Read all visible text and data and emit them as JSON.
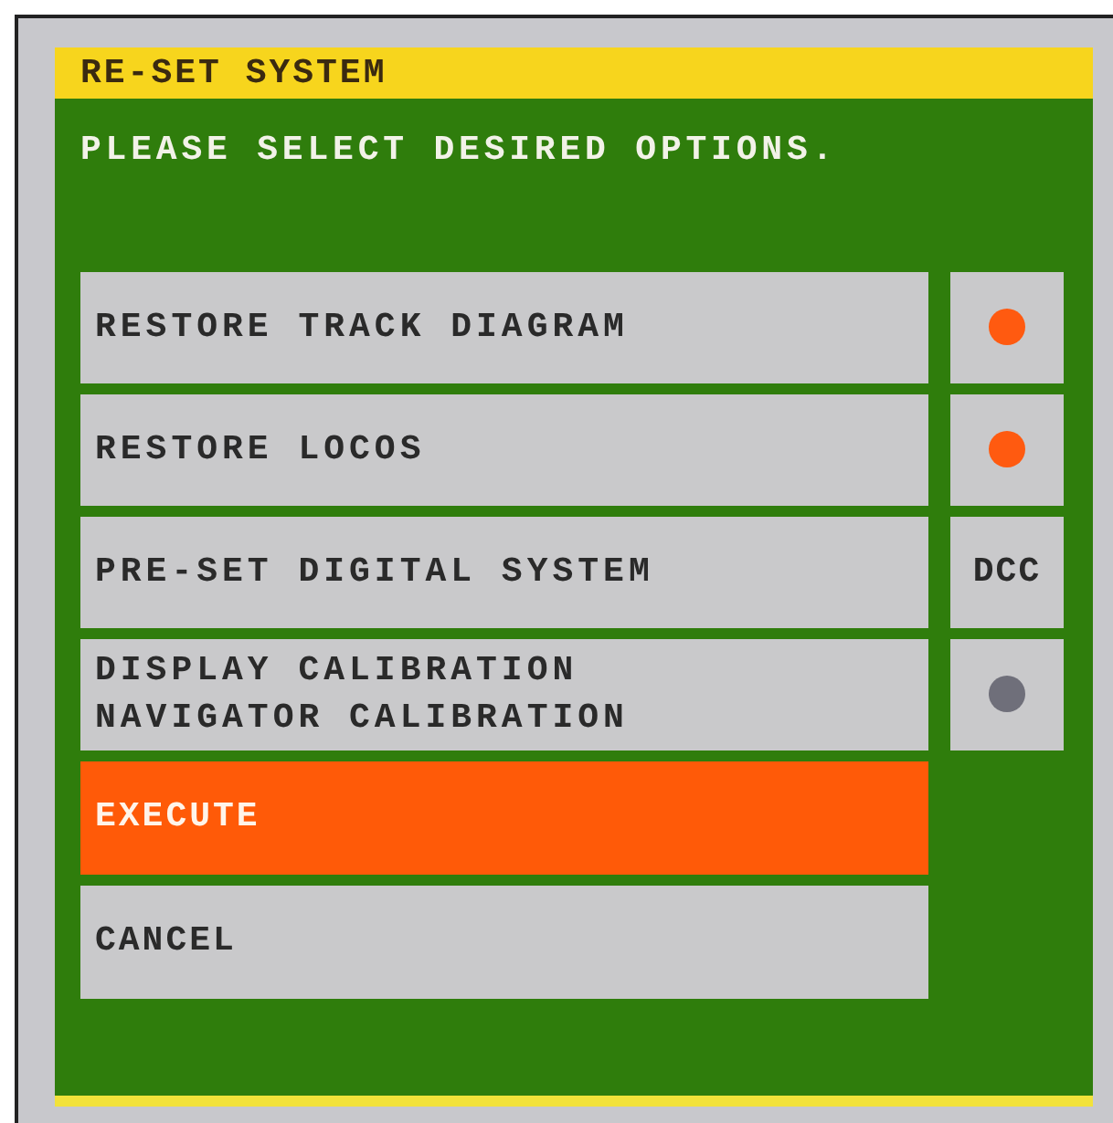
{
  "dialog": {
    "title": "RE-SET SYSTEM",
    "prompt": "PLEASE SELECT DESIRED OPTIONS.",
    "options": [
      {
        "kind": "toggle",
        "label": "RESTORE TRACK DIAGRAM",
        "on": true
      },
      {
        "kind": "toggle",
        "label": "RESTORE LOCOS",
        "on": true
      },
      {
        "kind": "value",
        "label": "PRE-SET DIGITAL SYSTEM",
        "value": "DCC"
      },
      {
        "kind": "toggle",
        "label": "DISPLAY CALIBRATION\nNAVIGATOR CALIBRATION",
        "on": false
      }
    ],
    "buttons": [
      {
        "kind": "primary",
        "label": "EXECUTE"
      },
      {
        "kind": "secondary",
        "label": "CANCEL"
      }
    ]
  }
}
